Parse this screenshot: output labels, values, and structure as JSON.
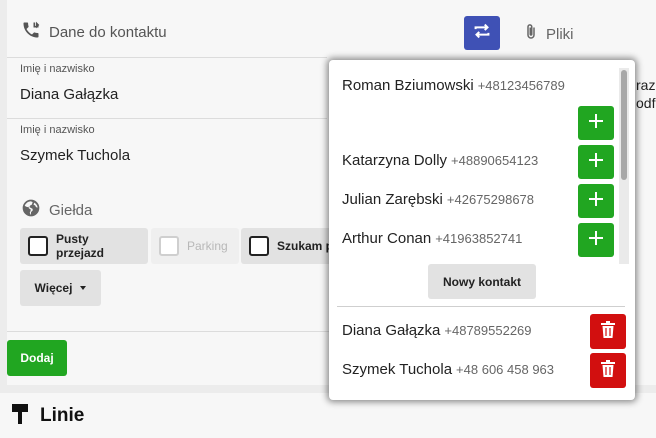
{
  "contact_section": {
    "title": "Dane do kontaktu",
    "icon": "phone-forward-icon"
  },
  "fields": [
    {
      "label": "Imię i nazwisko",
      "value": "Diana Gałązka"
    },
    {
      "label": "Imię i nazwisko",
      "value": "Szymek Tuchola"
    }
  ],
  "gielda": {
    "title": "Giełda",
    "icon": "globe-icon"
  },
  "checkboxes": [
    {
      "label": "Pusty przejazd",
      "checked": false,
      "disabled": false
    },
    {
      "label": "Parking",
      "checked": false,
      "disabled": true
    },
    {
      "label": "Szukam p",
      "checked": false,
      "disabled": false
    }
  ],
  "more_button": {
    "label": "Więcej"
  },
  "files": {
    "label": "Pliki",
    "icon": "paperclip-icon"
  },
  "clipped_right_text": [
    "razl",
    "odf"
  ],
  "add_button": {
    "label": "Dodaj"
  },
  "lines_section": {
    "title": "Linie",
    "icon": "signpost-icon"
  },
  "popup": {
    "contacts": [
      {
        "name": "Roman Bziumowski",
        "phone": "+48123456789"
      },
      {
        "name": "Katarzyna Dolly",
        "phone": "+48890654123"
      },
      {
        "name": "Julian Zarębski",
        "phone": "+42675298678"
      },
      {
        "name": "Arthur Conan",
        "phone": "+41963852741"
      }
    ],
    "new_contact_label": "Nowy kontakt",
    "selected": [
      {
        "name": "Diana Gałązka",
        "phone": "+48789552269"
      },
      {
        "name": "Szymek Tuchola",
        "phone": "+48 606 458 963"
      }
    ]
  },
  "colors": {
    "primary": "#3f51b5",
    "success": "#21a621",
    "danger": "#d20f0f"
  }
}
